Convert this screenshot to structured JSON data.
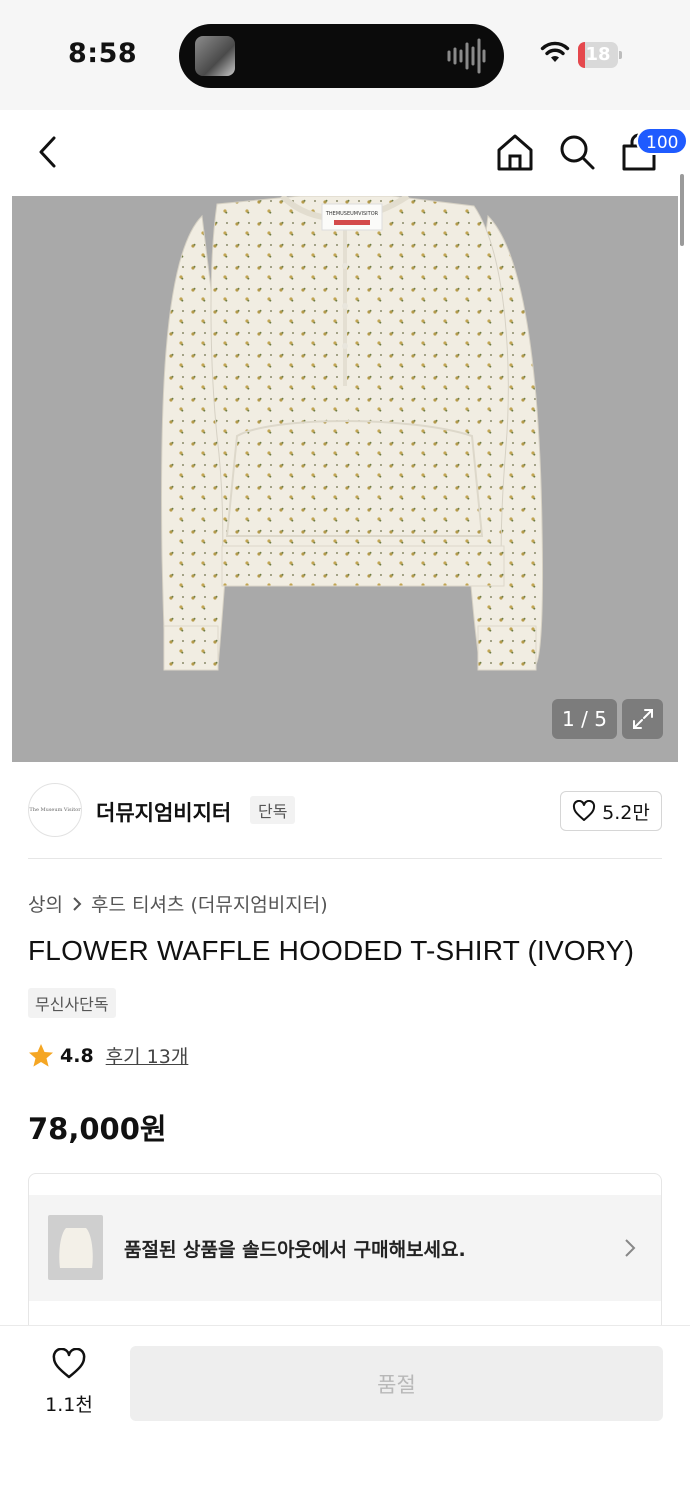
{
  "status_bar": {
    "time": "8:58",
    "battery": "18",
    "battery_level": 0.18,
    "colors": {
      "battery_low": "#e5484d"
    }
  },
  "nav": {
    "icons": [
      "back-icon",
      "home-icon",
      "search-icon",
      "shopping-bag-icon"
    ],
    "cart_count": "100",
    "colors": {
      "badge": "#1f5bff"
    }
  },
  "gallery": {
    "pager": "1 / 5",
    "product_label": "THEMUSEUMVISITOR",
    "background": "#a9a9a9"
  },
  "brand": {
    "logo_text": "The Museum Visitor",
    "name": "더뮤지엄비지터",
    "tag": "단독",
    "likes": "5.2만"
  },
  "product": {
    "breadcrumb": [
      "상의",
      "후드 티셔츠 (더뮤지엄비지터)"
    ],
    "title": "FLOWER WAFFLE HOODED T-SHIRT (IVORY)",
    "exclusive_tag": "무신사단독",
    "rating": "4.8",
    "reviews": "후기 13개",
    "price": "78,000원",
    "colors": {
      "star": "#f5a623"
    }
  },
  "soldout_banner": {
    "text": "품절된 상품을 솔드아웃에서 구매해보세요."
  },
  "bottom_bar": {
    "wish_count": "1.1천",
    "buy_label": "품절"
  }
}
